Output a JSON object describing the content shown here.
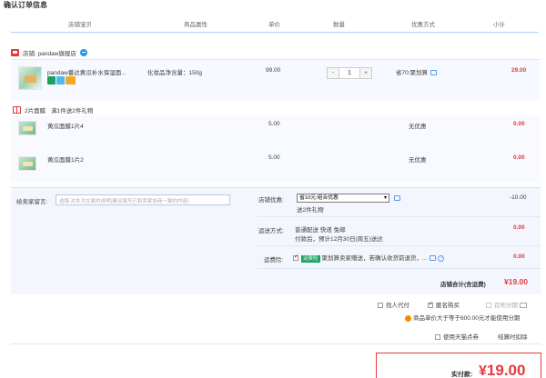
{
  "page": {
    "title": "确认订单信息"
  },
  "columns": [
    "店铺宝贝",
    "商品属性",
    "单价",
    "数量",
    "优惠方式",
    "小计"
  ],
  "shop": {
    "label": "店铺: pandaw旗舰店"
  },
  "item": {
    "name": "pandaw番达黄瓜补水保湿面...",
    "attr": "化妆品净含量：150g",
    "price": "99.00",
    "minus": "-",
    "qty": "1",
    "plus": "+",
    "discount": "省70:聚划算",
    "subtotal": "29.00"
  },
  "gift": {
    "title": "2片面膜",
    "desc": "满1件送2件礼物",
    "items": [
      {
        "name": "黄瓜面膜1片4",
        "price": "5.00",
        "discount": "无优惠",
        "subtotal": "0.00"
      },
      {
        "name": "黄瓜面膜1片2",
        "price": "5.00",
        "discount": "无优惠",
        "subtotal": "0.00"
      }
    ]
  },
  "note": {
    "label": "给卖家留言:",
    "placeholder": "选填:对本次交易的说明(建议填写已和卖家协商一致的内容)"
  },
  "shop_coupon": {
    "label": "店铺优惠:",
    "selected": "省10元:组合优惠",
    "gift_text": "送2件礼物",
    "value": "-10.00"
  },
  "shipping": {
    "label": "运送方式:",
    "method": "普通配送 快递 免邮",
    "eta": "付款后，预计12月30日(周五)送达",
    "value": "0.00"
  },
  "insurance": {
    "label": "运费险:",
    "tag": "运费险",
    "text": "聚划算卖家赠送，若确认收货前退货，...",
    "help": "?",
    "value": "0.00"
  },
  "shop_total": {
    "label": "店铺合计(含运费)",
    "value": "¥19.00"
  },
  "options": {
    "proxy_pay": "找人代付",
    "anonymous": "匿名购买",
    "installment": "花呗分期",
    "installment_note": "商品单价大于等于600.00元才能使用分期",
    "tmall_points": "使用天猫点券",
    "deduct": "结算时扣除"
  },
  "payment": {
    "label": "实付款:",
    "currency": "¥",
    "amount": "19.00"
  },
  "colors": {
    "accent_red": "#e4393c",
    "header_blue": "#b2d1ff",
    "panel_bg": "#f3f7fd"
  }
}
